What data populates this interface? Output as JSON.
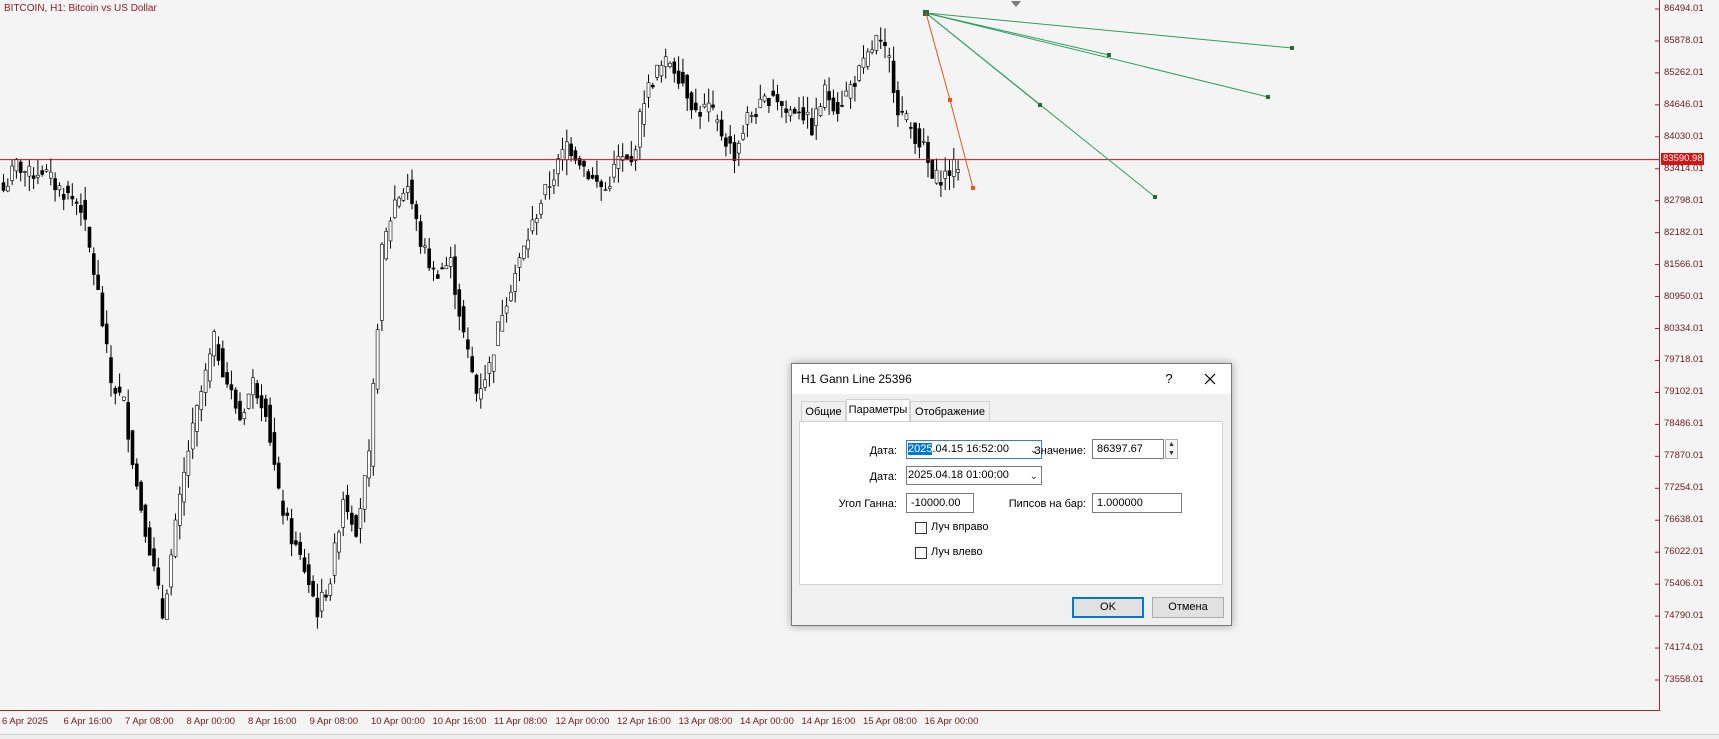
{
  "chart": {
    "symbol_title": "BITCOIN, H1:  Bitcoin vs US Dollar",
    "current_price": "83590.98",
    "price_ticks": [
      "86494.01",
      "85878.01",
      "85262.01",
      "84646.01",
      "84030.01",
      "83414.01",
      "82798.01",
      "82182.01",
      "81566.01",
      "80950.01",
      "80334.01",
      "79718.01",
      "79102.01",
      "78486.01",
      "77870.01",
      "77254.01",
      "76638.01",
      "76022.01",
      "75406.01",
      "74790.01",
      "74174.01",
      "73558.01"
    ],
    "time_ticks": [
      "6 Apr 2025",
      "6 Apr 16:00",
      "7 Apr 08:00",
      "8 Apr 00:00",
      "8 Apr 16:00",
      "9 Apr 08:00",
      "10 Apr 00:00",
      "10 Apr 16:00",
      "11 Apr 08:00",
      "12 Apr 00:00",
      "12 Apr 16:00",
      "13 Apr 08:00",
      "14 Apr 00:00",
      "14 Apr 16:00",
      "15 Apr 08:00",
      "16 Apr 00:00"
    ],
    "colors": {
      "up": "#ffffff",
      "down": "#000000",
      "price_line": "#cc1111",
      "gann": "#2e9e5e",
      "axis_text": "#6b1818"
    },
    "chart_data": {
      "type": "candlestick",
      "ylim": [
        73558.01,
        86494.01
      ],
      "close_path": [
        [
          0,
          83000
        ],
        [
          3,
          83500
        ],
        [
          6,
          83300
        ],
        [
          9,
          83400
        ],
        [
          12,
          83100
        ],
        [
          15,
          82900
        ],
        [
          18,
          82700
        ],
        [
          22,
          81000
        ],
        [
          25,
          79300
        ],
        [
          28,
          78900
        ],
        [
          31,
          77300
        ],
        [
          34,
          76100
        ],
        [
          37,
          74800
        ],
        [
          40,
          76500
        ],
        [
          43,
          78000
        ],
        [
          46,
          79100
        ],
        [
          49,
          80100
        ],
        [
          52,
          79300
        ],
        [
          55,
          78600
        ],
        [
          58,
          79300
        ],
        [
          61,
          78800
        ],
        [
          64,
          77100
        ],
        [
          67,
          76300
        ],
        [
          70,
          75700
        ],
        [
          73,
          74900
        ],
        [
          76,
          75500
        ],
        [
          79,
          77100
        ],
        [
          82,
          76500
        ],
        [
          85,
          77800
        ],
        [
          88,
          81800
        ],
        [
          91,
          82800
        ],
        [
          94,
          83100
        ],
        [
          97,
          82000
        ],
        [
          100,
          81400
        ],
        [
          104,
          81600
        ],
        [
          107,
          80200
        ],
        [
          110,
          79100
        ],
        [
          113,
          79600
        ],
        [
          116,
          80700
        ],
        [
          119,
          81400
        ],
        [
          122,
          82100
        ],
        [
          125,
          82800
        ],
        [
          128,
          83300
        ],
        [
          131,
          83900
        ],
        [
          134,
          83600
        ],
        [
          137,
          83200
        ],
        [
          140,
          83000
        ],
        [
          143,
          83600
        ],
        [
          146,
          83500
        ],
        [
          149,
          84800
        ],
        [
          152,
          85300
        ],
        [
          155,
          85500
        ],
        [
          158,
          85100
        ],
        [
          161,
          84500
        ],
        [
          164,
          84600
        ],
        [
          167,
          84100
        ],
        [
          170,
          83700
        ],
        [
          173,
          84400
        ],
        [
          176,
          84600
        ],
        [
          179,
          84900
        ],
        [
          182,
          84500
        ],
        [
          185,
          84600
        ],
        [
          188,
          84200
        ],
        [
          191,
          84900
        ],
        [
          194,
          84600
        ],
        [
          197,
          85000
        ],
        [
          200,
          85400
        ],
        [
          203,
          85900
        ],
        [
          206,
          85500
        ],
        [
          208,
          84600
        ],
        [
          211,
          84200
        ],
        [
          214,
          83800
        ],
        [
          216,
          83200
        ],
        [
          219,
          83300
        ],
        [
          222,
          83500
        ]
      ],
      "gann_line": {
        "from": [
          "2025.04.15 16:52:00",
          86397.67
        ],
        "to": [
          "2025.04.18 01:00:00",
          null
        ],
        "angle": -10000.0,
        "pips_per_bar": 1.0
      }
    }
  },
  "dialog": {
    "title": "H1 Gann Line 25396",
    "help": "?",
    "close": "✕",
    "tabs": [
      "Общие",
      "Параметры",
      "Отображение"
    ],
    "date1_label": "Дата:",
    "date1_selected": "2025",
    "date1_rest": ".04.15 16:52:00",
    "value_label": "Значение:",
    "value": "86397.67",
    "date2_label": "Дата:",
    "date2": "2025.04.18 01:00:00",
    "angle_label": "Угол Ганна:",
    "angle": "-10000.00",
    "pips_label": "Пипсов на бар:",
    "pips": "1.000000",
    "ray_right": "Луч вправо",
    "ray_left": "Луч влево",
    "ok": "OK",
    "cancel": "Отмена"
  }
}
